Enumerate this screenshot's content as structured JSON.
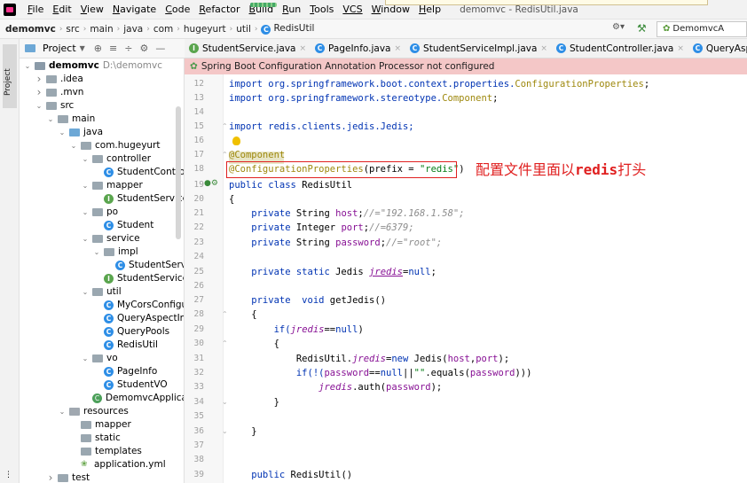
{
  "menu": {
    "items": [
      {
        "mn": "F",
        "rest": "ile"
      },
      {
        "mn": "E",
        "rest": "dit"
      },
      {
        "mn": "V",
        "rest": "iew"
      },
      {
        "mn": "N",
        "rest": "avigate"
      },
      {
        "mn": "C",
        "rest": "ode"
      },
      {
        "mn": "R",
        "rest": "efactor"
      },
      {
        "mn": "B",
        "rest": "uild"
      },
      {
        "mn": "R",
        "rest": "un"
      },
      {
        "mn": "T",
        "rest": "ools"
      },
      {
        "mn": "VCS",
        "rest": ""
      },
      {
        "mn": "W",
        "rest": "indow"
      },
      {
        "mn": "H",
        "rest": "elp"
      }
    ],
    "window_title": "demomvc - RedisUtil.java"
  },
  "breadcrumb": [
    "demomvc",
    "src",
    "main",
    "java",
    "com",
    "hugeyurt",
    "util",
    "RedisUtil"
  ],
  "run_config": "DemomvcA",
  "project_panel": {
    "title": "Project",
    "tree": [
      {
        "depth": 0,
        "chev": "v",
        "icon": "folder-mod",
        "label": "demomvc",
        "bold": true,
        "path": "D:\\demomvc"
      },
      {
        "depth": 1,
        "chev": ">",
        "icon": "folder",
        "label": ".idea"
      },
      {
        "depth": 1,
        "chev": ">",
        "icon": "folder",
        "label": ".mvn"
      },
      {
        "depth": 1,
        "chev": "v",
        "icon": "folder",
        "label": "src"
      },
      {
        "depth": 2,
        "chev": "v",
        "icon": "folder",
        "label": "main"
      },
      {
        "depth": 3,
        "chev": "v",
        "icon": "folder-blue",
        "label": "java"
      },
      {
        "depth": 4,
        "chev": "v",
        "icon": "folder",
        "label": "com.hugeyurt"
      },
      {
        "depth": 5,
        "chev": "v",
        "icon": "folder",
        "label": "controller"
      },
      {
        "depth": 6,
        "chev": "",
        "icon": "class",
        "label": "StudentControlle"
      },
      {
        "depth": 5,
        "chev": "v",
        "icon": "folder",
        "label": "mapper"
      },
      {
        "depth": 6,
        "chev": "",
        "icon": "interface",
        "label": "StudentServiceM"
      },
      {
        "depth": 5,
        "chev": "v",
        "icon": "folder",
        "label": "po"
      },
      {
        "depth": 6,
        "chev": "",
        "icon": "class",
        "label": "Student"
      },
      {
        "depth": 5,
        "chev": "v",
        "icon": "folder",
        "label": "service"
      },
      {
        "depth": 6,
        "chev": "v",
        "icon": "folder",
        "label": "impl"
      },
      {
        "depth": 7,
        "chev": "",
        "icon": "class",
        "label": "StudentServic"
      },
      {
        "depth": 6,
        "chev": "",
        "icon": "interface",
        "label": "StudentService"
      },
      {
        "depth": 5,
        "chev": "v",
        "icon": "folder",
        "label": "util"
      },
      {
        "depth": 6,
        "chev": "",
        "icon": "class",
        "label": "MyCorsConfigura"
      },
      {
        "depth": 6,
        "chev": "",
        "icon": "class",
        "label": "QueryAspectInfo"
      },
      {
        "depth": 6,
        "chev": "",
        "icon": "class",
        "label": "QueryPools"
      },
      {
        "depth": 6,
        "chev": "",
        "icon": "class",
        "label": "RedisUtil"
      },
      {
        "depth": 5,
        "chev": "v",
        "icon": "folder",
        "label": "vo"
      },
      {
        "depth": 6,
        "chev": "",
        "icon": "class",
        "label": "PageInfo"
      },
      {
        "depth": 6,
        "chev": "",
        "icon": "class",
        "label": "StudentVO"
      },
      {
        "depth": 5,
        "chev": "",
        "icon": "springboot",
        "label": "DemomvcApplicati"
      },
      {
        "depth": 3,
        "chev": "v",
        "icon": "folder-res",
        "label": "resources"
      },
      {
        "depth": 4,
        "chev": "",
        "icon": "folder",
        "label": "mapper"
      },
      {
        "depth": 4,
        "chev": "",
        "icon": "folder",
        "label": "static"
      },
      {
        "depth": 4,
        "chev": "",
        "icon": "folder",
        "label": "templates"
      },
      {
        "depth": 4,
        "chev": "",
        "icon": "yml",
        "label": "application.yml"
      },
      {
        "depth": 2,
        "chev": ">",
        "icon": "folder",
        "label": "test"
      }
    ]
  },
  "tabs": [
    {
      "icon": "interface",
      "label": "StudentService.java"
    },
    {
      "icon": "class",
      "label": "PageInfo.java"
    },
    {
      "icon": "class",
      "label": "StudentServiceImpl.java"
    },
    {
      "icon": "class",
      "label": "StudentController.java"
    },
    {
      "icon": "class",
      "label": "QueryAspectInfo.java"
    },
    {
      "icon": "class",
      "label": "C"
    }
  ],
  "banner": "Spring Boot Configuration Annotation Processor not configured",
  "line_numbers": [
    "12",
    "13",
    "14",
    "15",
    "16",
    "17",
    "18",
    "19",
    "20",
    "21",
    "22",
    "23",
    "24",
    "25",
    "26",
    "27",
    "28",
    "29",
    "30",
    "31",
    "32",
    "33",
    "34",
    "35",
    "36",
    "37",
    "38",
    "39"
  ],
  "code": {
    "l12_a": "import org.springframework.boot.context.properties.",
    "l12_b": "ConfigurationProperties",
    "l12_c": ";",
    "l13_a": "import org.springframework.stereotype.",
    "l13_b": "Component",
    "l13_c": ";",
    "l15": "import redis.clients.jedis.Jedis;",
    "l17": "@Component",
    "l18_a": "@ConfigurationProperties",
    "l18_b": "(prefix = ",
    "l18_c": "\"redis\"",
    "l18_d": ")",
    "l19_a": "public class ",
    "l19_b": "RedisUtil",
    "l20": "{",
    "l21_a": "    private ",
    "l21_b": "String ",
    "l21_c": "host",
    "l21_d": ";",
    "l21_e": "//=\"192.168.1.58\";",
    "l22_a": "    private ",
    "l22_b": "Integer ",
    "l22_c": "port",
    "l22_d": ";",
    "l22_e": "//=6379;",
    "l23_a": "    private ",
    "l23_b": "String ",
    "l23_c": "password",
    "l23_d": ";",
    "l23_e": "//=\"root\";",
    "l25_a": "    private static ",
    "l25_b": "Jedis ",
    "l25_c": "jredis",
    "l25_d": "=",
    "l25_e": "null",
    "l25_f": ";",
    "l27_a": "    private  void ",
    "l27_b": "getJedis()",
    "l28": "    {",
    "l29_a": "        if(",
    "l29_b": "jredis",
    "l29_c": "==",
    "l29_d": "null",
    "l29_e": ")",
    "l30": "        {",
    "l31_a": "            RedisUtil.",
    "l31_b": "jredis",
    "l31_c": "=",
    "l31_d": "new ",
    "l31_e": "Jedis(",
    "l31_f": "host",
    "l31_g": ",",
    "l31_h": "port",
    "l31_i": ");",
    "l32_a": "            if(!(",
    "l32_b": "password",
    "l32_c": "==",
    "l32_d": "null",
    "l32_e": "||",
    "l32_f": "\"\"",
    "l32_g": ".equals(",
    "l32_h": "password",
    "l32_i": ")))",
    "l33_a": "                ",
    "l33_b": "jredis",
    "l33_c": ".auth(",
    "l33_d": "password",
    "l33_e": ");",
    "l34": "        }",
    "l36": "    }",
    "l39_a": "    public ",
    "l39_b": "RedisUtil()"
  },
  "callout": {
    "text_a": "配置文件里面以",
    "text_b": "redis",
    "text_c": "打头"
  },
  "colors": {
    "keyword": "#0033b3",
    "string": "#067d17",
    "annotation": "#9e880d",
    "comment": "#8c8c8c",
    "field": "#871094",
    "callout": "#e02020",
    "banner": "#f4c7c7"
  }
}
